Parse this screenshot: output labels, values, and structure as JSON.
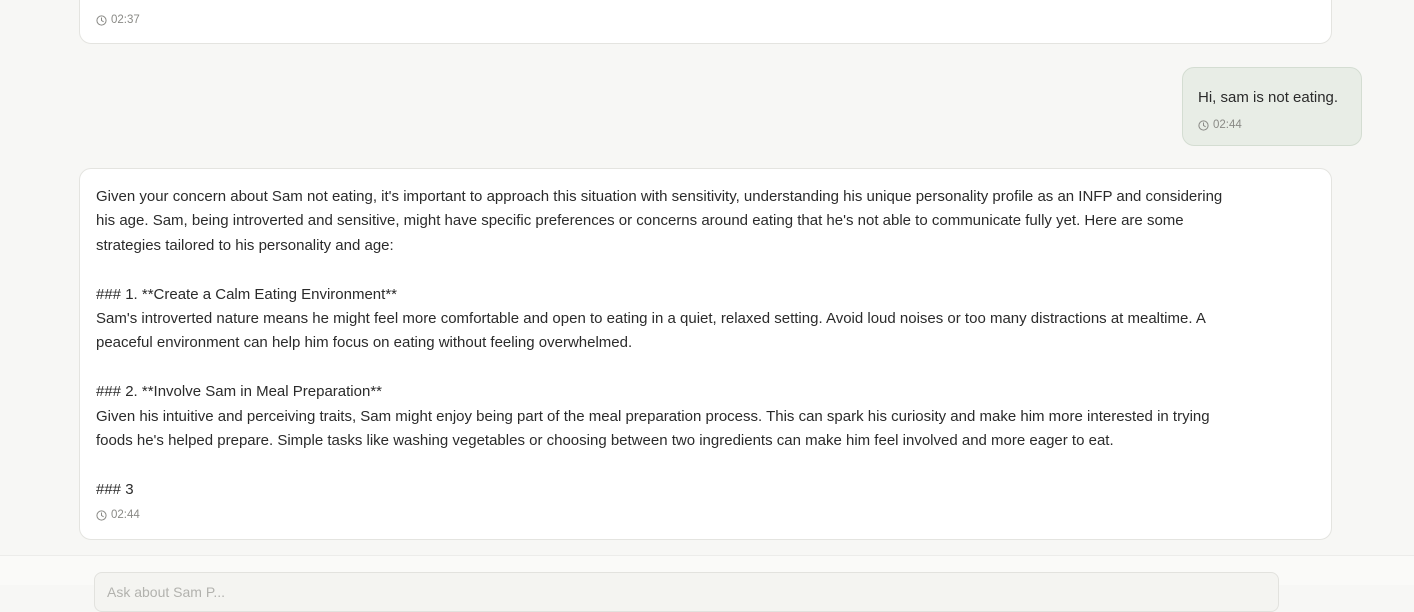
{
  "messages": {
    "previous_ai": {
      "timestamp": "02:37"
    },
    "user": {
      "text": "Hi, sam is not eating.",
      "timestamp": "02:44"
    },
    "assistant": {
      "lines": [
        "Given your concern about Sam not eating, it's important to approach this situation with sensitivity, understanding his unique personality profile as an INFP and considering",
        "his age. Sam, being introverted and sensitive, might have specific preferences or concerns around eating that he's not able to communicate fully yet. Here are some",
        "strategies tailored to his personality and age:",
        "",
        "### 1. **Create a Calm Eating Environment**",
        "Sam's introverted nature means he might feel more comfortable and open to eating in a quiet, relaxed setting. Avoid loud noises or too many distractions at mealtime. A",
        "peaceful environment can help him focus on eating without feeling overwhelmed.",
        "",
        "### 2. **Involve Sam in Meal Preparation**",
        "Given his intuitive and perceiving traits, Sam might enjoy being part of the meal preparation process. This can spark his curiosity and make him more interested in trying",
        "foods he's helped prepare. Simple tasks like washing vegetables or choosing between two ingredients can make him feel involved and more eager to eat.",
        "",
        "### 3"
      ],
      "timestamp": "02:44"
    }
  },
  "composer": {
    "placeholder": "Ask about Sam P..."
  },
  "icons": {
    "timestamp": "clock-icon"
  }
}
